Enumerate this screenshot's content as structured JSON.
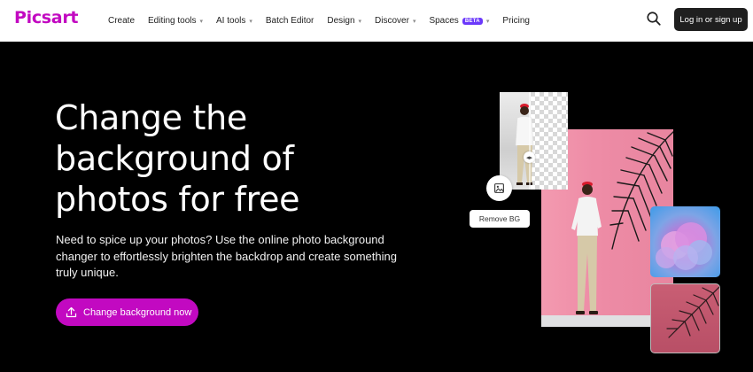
{
  "header": {
    "logo": "Picsart",
    "nav": [
      {
        "label": "Create",
        "dropdown": false
      },
      {
        "label": "Editing tools",
        "dropdown": true
      },
      {
        "label": "AI tools",
        "dropdown": true
      },
      {
        "label": "Batch Editor",
        "dropdown": false
      },
      {
        "label": "Design",
        "dropdown": true
      },
      {
        "label": "Discover",
        "dropdown": true
      },
      {
        "label": "Spaces",
        "badge": "BETA",
        "dropdown": true
      },
      {
        "label": "Pricing",
        "dropdown": false
      }
    ],
    "login_label": "Log in or sign up",
    "icons": {
      "search": "search-icon"
    }
  },
  "hero": {
    "headline": "Change the background of photos for free",
    "subtext": "Need to spice up your photos? Use the online photo background changer to effortlessly brighten the backdrop and create something truly unique.",
    "cta_label": "Change background now",
    "cta_icon": "upload-icon"
  },
  "collage": {
    "tool_label": "Remove BG",
    "tool_icon": "image-icon"
  },
  "colors": {
    "brand": "#c209c1",
    "beta_badge": "#6b38fb",
    "background": "#000000",
    "login_button": "#1f1f1f",
    "photo_pink": "#ee8ca6"
  }
}
